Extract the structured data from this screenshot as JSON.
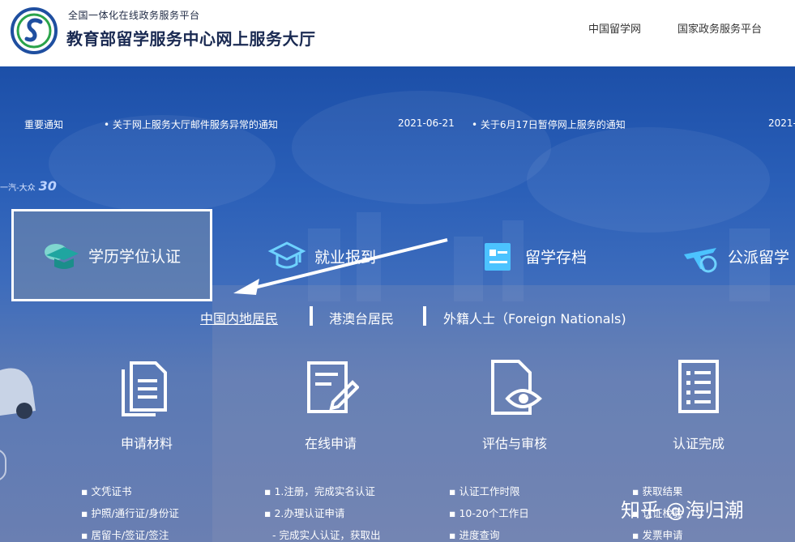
{
  "header": {
    "sub_title": "全国一体化在线政务服务平台",
    "main_title": "教育部留学服务中心网上服务大厅",
    "links": [
      "中国留学网",
      "国家政务服务平台"
    ]
  },
  "notice": {
    "label": "重要通知",
    "items": [
      {
        "text": "• 关于网上服务大厅邮件服务异常的通知",
        "date": "2021-06-21"
      },
      {
        "text": "• 关于6月17日暂停网上服务的通知",
        "date": "2021-"
      }
    ]
  },
  "badge": {
    "text": "一汽-大众",
    "number": "30"
  },
  "tabs": [
    {
      "label": "学历学位认证",
      "icon": "graduation-cap-icon",
      "active": true
    },
    {
      "label": "就业报到",
      "icon": "mortarboard-icon"
    },
    {
      "label": "留学存档",
      "icon": "archive-icon"
    },
    {
      "label": "公派留学",
      "icon": "airplane-icon"
    }
  ],
  "residents": [
    "中国内地居民",
    "港澳台居民",
    "外籍人士（Foreign Nationals)"
  ],
  "steps": [
    {
      "title": "申请材料",
      "icon": "documents-icon",
      "bullets": [
        "▪ 文凭证书",
        "▪ 护照/通行证/身份证",
        "▪ 居留卡/签证/签注"
      ]
    },
    {
      "title": "在线申请",
      "icon": "form-edit-icon",
      "bullets": [
        "▪ 1.注册，完成实名认证",
        "▪ 2.办理认证申请",
        "  - 完成实人认证，获取出"
      ]
    },
    {
      "title": "评估与审核",
      "icon": "document-eye-icon",
      "bullets": [
        "▪ 认证工作时限",
        "▪ 10-20个工作日",
        "▪ 进度查询"
      ]
    },
    {
      "title": "认证完成",
      "icon": "checklist-icon",
      "bullets": [
        "▪ 获取结果",
        "▪ 认证检验",
        "▪ 发票申请"
      ]
    }
  ],
  "watermark": "知乎 @海归潮",
  "colors": {
    "hero_top": "#1c4fa8",
    "hero_bottom": "#6a7fb2",
    "title": "#1a2a52"
  }
}
